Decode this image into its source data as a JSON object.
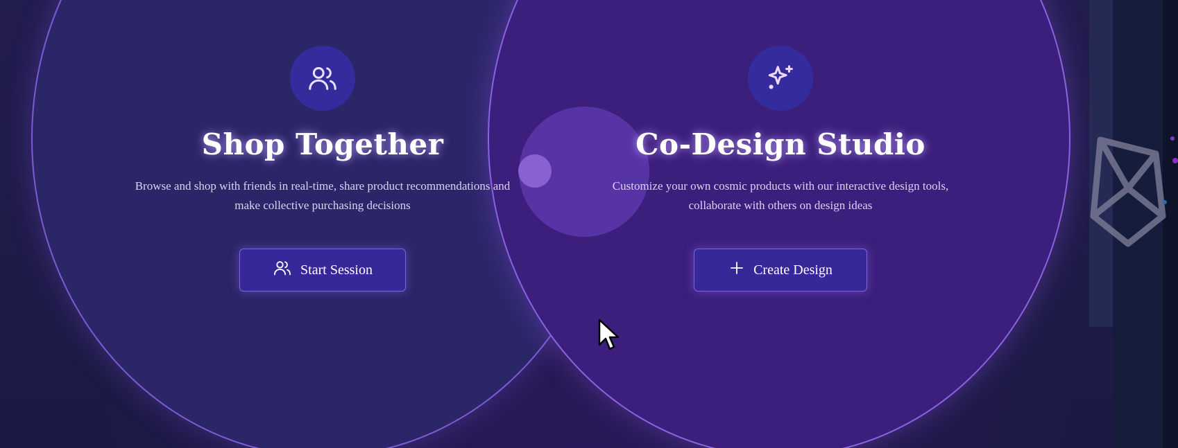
{
  "cards": [
    {
      "icon": "users-icon",
      "title": "Shop Together",
      "description_line1": "Browse and shop with friends in real-time, share product recommendations and",
      "description_line2": "make collective purchasing decisions",
      "button_icon": "users-icon",
      "button_label": "Start Session"
    },
    {
      "icon": "sparkles-icon",
      "title": "Co-Design Studio",
      "description": "Customize your own cosmic products with our interactive design tools, collaborate with others on design ideas",
      "button_icon": "plus-icon",
      "button_label": "Create Design"
    }
  ],
  "colors": {
    "accent": "#8b62e0",
    "button_bg": "#37289a",
    "left_circle": "#2b2668",
    "right_circle": "#3c1f7c"
  }
}
